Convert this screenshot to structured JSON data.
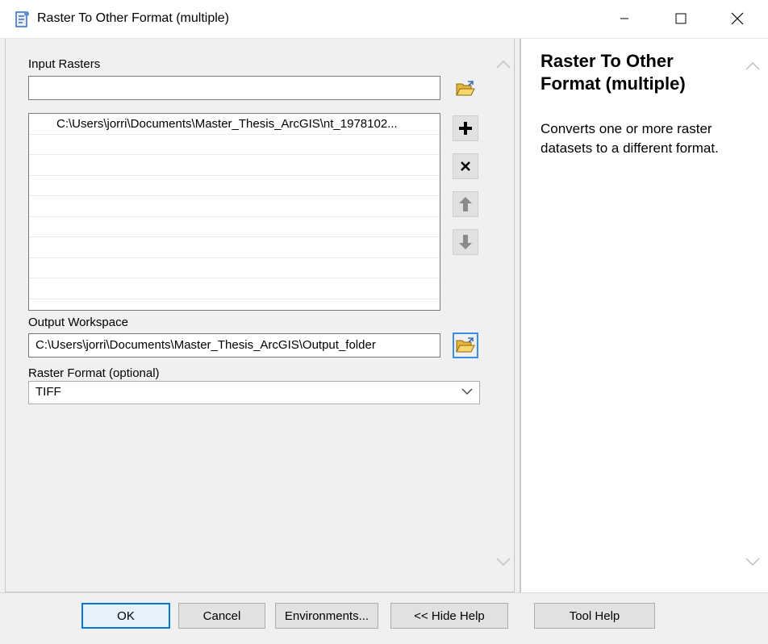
{
  "window": {
    "title": "Raster To Other Format (multiple)",
    "icon": "arcgis-tool-icon"
  },
  "form": {
    "input_rasters": {
      "label": "Input Rasters",
      "value": "",
      "list": [
        "C:\\Users\\jorri\\Documents\\Master_Thesis_ArcGIS\\nt_1978102..."
      ]
    },
    "output_workspace": {
      "label": "Output Workspace",
      "value": "C:\\Users\\jorri\\Documents\\Master_Thesis_ArcGIS\\Output_folder"
    },
    "raster_format": {
      "label": "Raster Format (optional)",
      "selected": "TIFF"
    }
  },
  "help": {
    "title": "Raster To Other Format (multiple)",
    "description": "Converts one or more raster datasets to a different format."
  },
  "buttons": {
    "ok": "OK",
    "cancel": "Cancel",
    "environments": "Environments...",
    "hide_help": "<< Hide Help",
    "tool_help": "Tool Help"
  },
  "colors": {
    "accent": "#0078d7",
    "folder_yellow": "#f2c94c"
  }
}
